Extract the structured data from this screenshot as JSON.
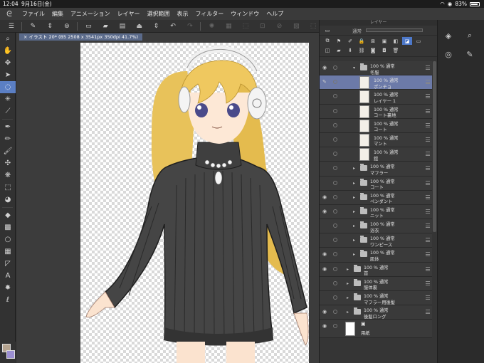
{
  "status": {
    "time": "12:04",
    "date": "9月16日(金)",
    "battery": "83%"
  },
  "menu": [
    "ファイル",
    "編集",
    "アニメーション",
    "レイヤー",
    "選択範囲",
    "表示",
    "フィルター",
    "ウィンドウ",
    "ヘルプ"
  ],
  "document_tab": "イラスト 20* (B5 2508 x 3541px 350dpi 41.7%)",
  "layer_panel": {
    "title": "レイヤー",
    "blend_mode": "通常",
    "layers": [
      {
        "pct": "100 %  通常",
        "name": "冬服",
        "type": "folder",
        "indent": 1,
        "expanded": true,
        "visible": true,
        "selected": false
      },
      {
        "pct": "100 %  通常",
        "name": "ポンチョ",
        "type": "raster",
        "indent": 2,
        "visible": false,
        "selected": true
      },
      {
        "pct": "100 %  通常",
        "name": "レイヤー 1",
        "type": "raster",
        "indent": 2,
        "visible": false,
        "selected": false
      },
      {
        "pct": "100 %  通常",
        "name": "コート裏地",
        "type": "raster",
        "indent": 2,
        "visible": false,
        "selected": false
      },
      {
        "pct": "100 %  通常",
        "name": "コート",
        "type": "raster",
        "indent": 2,
        "visible": false,
        "selected": false
      },
      {
        "pct": "100 %  通常",
        "name": "マント",
        "type": "raster",
        "indent": 2,
        "visible": false,
        "selected": false
      },
      {
        "pct": "100 %  通常",
        "name": "鎧",
        "type": "raster",
        "indent": 2,
        "visible": false,
        "selected": false
      },
      {
        "pct": "100 %  通常",
        "name": "マフラー",
        "type": "folder",
        "indent": 1,
        "visible": false,
        "selected": false
      },
      {
        "pct": "100 %  通常",
        "name": "コート",
        "type": "folder",
        "indent": 1,
        "visible": false,
        "selected": false
      },
      {
        "pct": "100 %  通常",
        "name": "ペンダント",
        "type": "folder",
        "indent": 1,
        "visible": true,
        "selected": false
      },
      {
        "pct": "100 %  通常",
        "name": "ニット",
        "type": "folder",
        "indent": 1,
        "visible": true,
        "selected": false
      },
      {
        "pct": "100 %  通常",
        "name": "浴衣",
        "type": "folder",
        "indent": 1,
        "visible": false,
        "selected": false
      },
      {
        "pct": "100 %  通常",
        "name": "ワンピース",
        "type": "folder",
        "indent": 1,
        "visible": false,
        "selected": false
      },
      {
        "pct": "100 %  通常",
        "name": "肌体",
        "type": "folder",
        "indent": 1,
        "visible": true,
        "selected": false
      },
      {
        "pct": "100 %  通常",
        "name": "首",
        "type": "folder",
        "indent": 0,
        "visible": true,
        "selected": false
      },
      {
        "pct": "100 %  通常",
        "name": "服体裏",
        "type": "folder",
        "indent": 0,
        "visible": false,
        "selected": false
      },
      {
        "pct": "100 %  通常",
        "name": "マフラー用後髪",
        "type": "folder",
        "indent": 0,
        "visible": false,
        "selected": false
      },
      {
        "pct": "100 %  通常",
        "name": "後髪ロング",
        "type": "folder",
        "indent": 0,
        "visible": true,
        "selected": false
      }
    ],
    "paper": {
      "name": "用紙"
    }
  },
  "colors": {
    "accent": "#5b7fc4",
    "selected_layer": "#6c7aa8",
    "main_color": "#b5a38f",
    "sub_color": "#9c8fd1"
  }
}
